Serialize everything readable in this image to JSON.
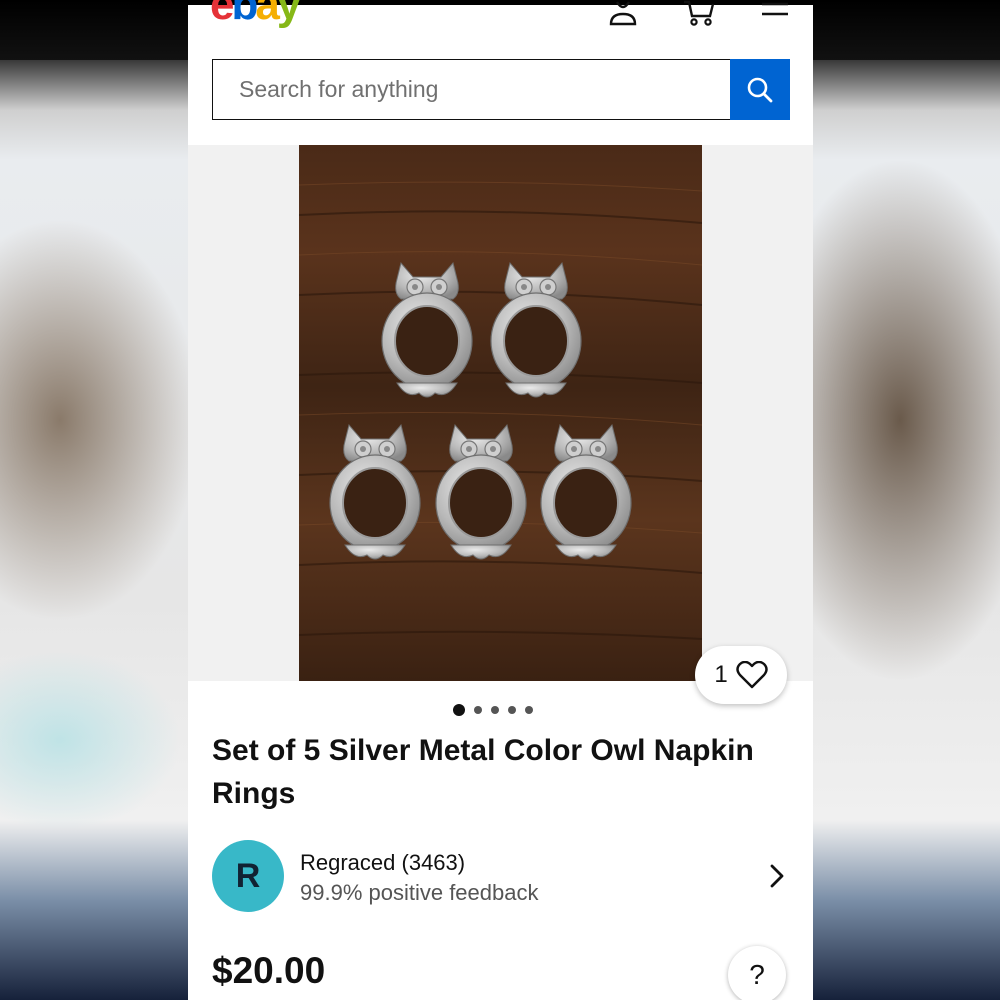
{
  "header": {
    "logo_letters": [
      "e",
      "b",
      "a",
      "y"
    ],
    "icons": [
      "user-icon",
      "cart-icon",
      "menu-icon"
    ]
  },
  "search": {
    "placeholder": "Search for anything",
    "button_icon": "search-icon",
    "button_color": "#0064d2"
  },
  "gallery": {
    "image_description_icon": "product-photo",
    "watch_count": "1",
    "dot_count": 5,
    "active_dot": 0
  },
  "listing": {
    "title": "Set of 5 Silver Metal Color Owl Napkin Rings",
    "price": "$20.00"
  },
  "seller": {
    "avatar_letter": "R",
    "avatar_color": "#38b8c8",
    "name": "Regraced (3463)",
    "feedback": "99.9% positive feedback"
  },
  "help": {
    "label": "?"
  }
}
